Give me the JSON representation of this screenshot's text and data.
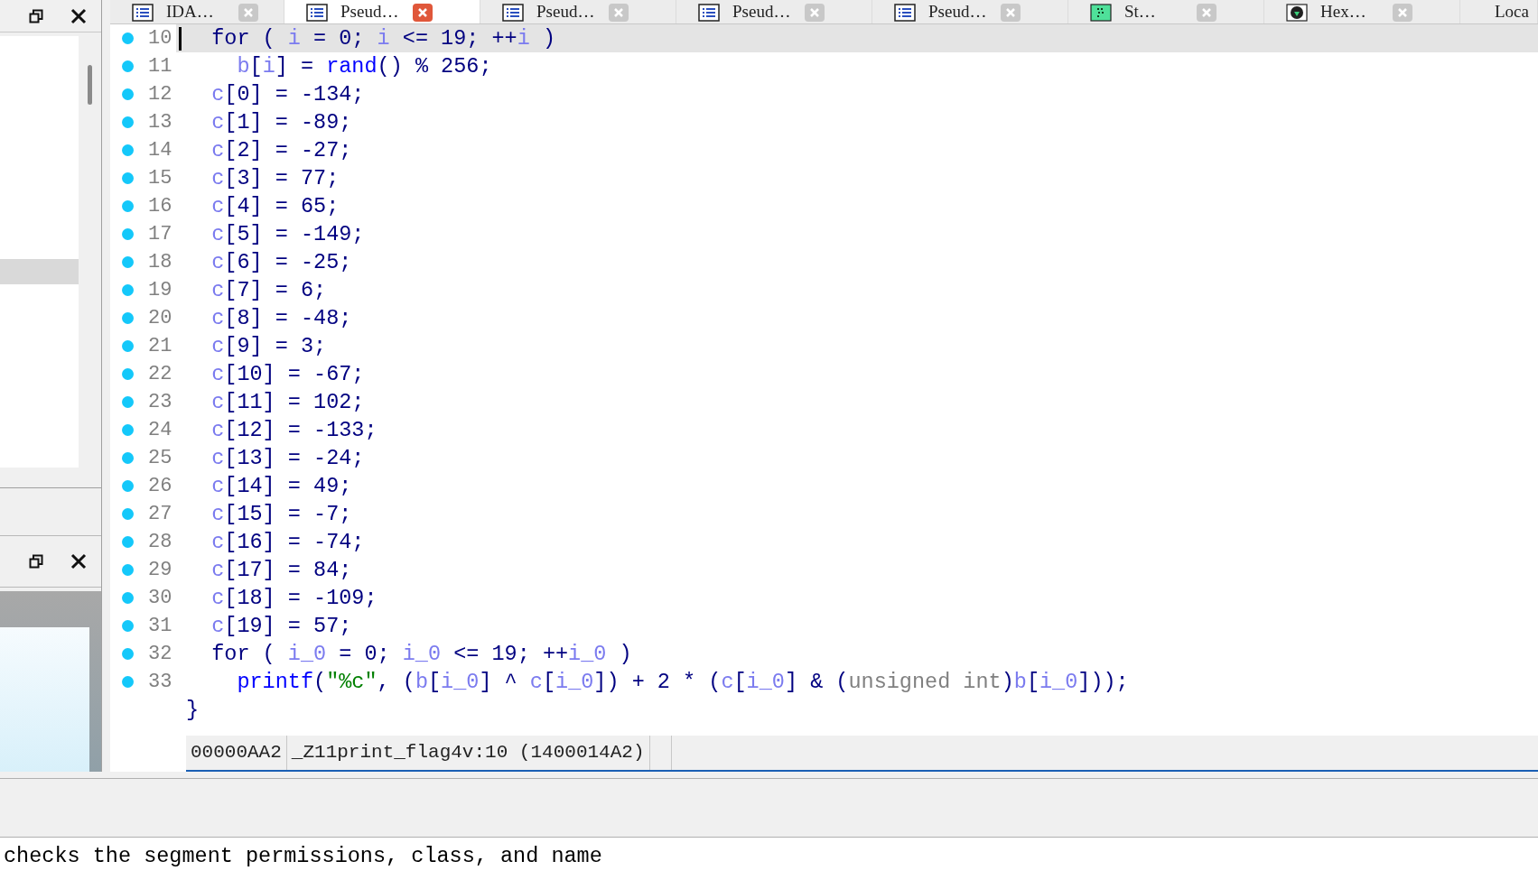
{
  "tabs": [
    {
      "label": "IDA…",
      "kind": "list",
      "selected": false
    },
    {
      "label": "Pseud…",
      "kind": "list",
      "selected": true
    },
    {
      "label": "Pseud…",
      "kind": "list",
      "selected": false
    },
    {
      "label": "Pseud…",
      "kind": "list",
      "selected": false
    },
    {
      "label": "Pseud…",
      "kind": "list",
      "selected": false
    },
    {
      "label": "St…",
      "kind": "strings",
      "selected": false
    },
    {
      "label": "Hex…",
      "kind": "hex",
      "selected": false
    },
    {
      "label": "Loca",
      "kind": "locals",
      "selected": false
    }
  ],
  "code_lines": [
    {
      "number": "10",
      "current": true,
      "tokens": [
        {
          "kind": "plain",
          "text": "  for ( "
        },
        {
          "kind": "var",
          "text": "i"
        },
        {
          "kind": "plain",
          "text": " = 0; "
        },
        {
          "kind": "var",
          "text": "i"
        },
        {
          "kind": "plain",
          "text": " <= 19; ++"
        },
        {
          "kind": "var",
          "text": "i"
        },
        {
          "kind": "plain",
          "text": " )"
        }
      ]
    },
    {
      "number": "11",
      "current": false,
      "tokens": [
        {
          "kind": "var",
          "text": "    b"
        },
        {
          "kind": "plain",
          "text": "["
        },
        {
          "kind": "var",
          "text": "i"
        },
        {
          "kind": "plain",
          "text": "] = "
        },
        {
          "kind": "func",
          "text": "rand"
        },
        {
          "kind": "plain",
          "text": "() % 256;"
        }
      ]
    },
    {
      "number": "12",
      "current": false,
      "tokens": [
        {
          "kind": "var",
          "text": "  c"
        },
        {
          "kind": "plain",
          "text": "[0] = -134;"
        }
      ]
    },
    {
      "number": "13",
      "current": false,
      "tokens": [
        {
          "kind": "var",
          "text": "  c"
        },
        {
          "kind": "plain",
          "text": "[1] = -89;"
        }
      ]
    },
    {
      "number": "14",
      "current": false,
      "tokens": [
        {
          "kind": "var",
          "text": "  c"
        },
        {
          "kind": "plain",
          "text": "[2] = -27;"
        }
      ]
    },
    {
      "number": "15",
      "current": false,
      "tokens": [
        {
          "kind": "var",
          "text": "  c"
        },
        {
          "kind": "plain",
          "text": "[3] = 77;"
        }
      ]
    },
    {
      "number": "16",
      "current": false,
      "tokens": [
        {
          "kind": "var",
          "text": "  c"
        },
        {
          "kind": "plain",
          "text": "[4] = 65;"
        }
      ]
    },
    {
      "number": "17",
      "current": false,
      "tokens": [
        {
          "kind": "var",
          "text": "  c"
        },
        {
          "kind": "plain",
          "text": "[5] = -149;"
        }
      ]
    },
    {
      "number": "18",
      "current": false,
      "tokens": [
        {
          "kind": "var",
          "text": "  c"
        },
        {
          "kind": "plain",
          "text": "[6] = -25;"
        }
      ]
    },
    {
      "number": "19",
      "current": false,
      "tokens": [
        {
          "kind": "var",
          "text": "  c"
        },
        {
          "kind": "plain",
          "text": "[7] = 6;"
        }
      ]
    },
    {
      "number": "20",
      "current": false,
      "tokens": [
        {
          "kind": "var",
          "text": "  c"
        },
        {
          "kind": "plain",
          "text": "[8] = -48;"
        }
      ]
    },
    {
      "number": "21",
      "current": false,
      "tokens": [
        {
          "kind": "var",
          "text": "  c"
        },
        {
          "kind": "plain",
          "text": "[9] = 3;"
        }
      ]
    },
    {
      "number": "22",
      "current": false,
      "tokens": [
        {
          "kind": "var",
          "text": "  c"
        },
        {
          "kind": "plain",
          "text": "[10] = -67;"
        }
      ]
    },
    {
      "number": "23",
      "current": false,
      "tokens": [
        {
          "kind": "var",
          "text": "  c"
        },
        {
          "kind": "plain",
          "text": "[11] = 102;"
        }
      ]
    },
    {
      "number": "24",
      "current": false,
      "tokens": [
        {
          "kind": "var",
          "text": "  c"
        },
        {
          "kind": "plain",
          "text": "[12] = -133;"
        }
      ]
    },
    {
      "number": "25",
      "current": false,
      "tokens": [
        {
          "kind": "var",
          "text": "  c"
        },
        {
          "kind": "plain",
          "text": "[13] = -24;"
        }
      ]
    },
    {
      "number": "26",
      "current": false,
      "tokens": [
        {
          "kind": "var",
          "text": "  c"
        },
        {
          "kind": "plain",
          "text": "[14] = 49;"
        }
      ]
    },
    {
      "number": "27",
      "current": false,
      "tokens": [
        {
          "kind": "var",
          "text": "  c"
        },
        {
          "kind": "plain",
          "text": "[15] = -7;"
        }
      ]
    },
    {
      "number": "28",
      "current": false,
      "tokens": [
        {
          "kind": "var",
          "text": "  c"
        },
        {
          "kind": "plain",
          "text": "[16] = -74;"
        }
      ]
    },
    {
      "number": "29",
      "current": false,
      "tokens": [
        {
          "kind": "var",
          "text": "  c"
        },
        {
          "kind": "plain",
          "text": "[17] = 84;"
        }
      ]
    },
    {
      "number": "30",
      "current": false,
      "tokens": [
        {
          "kind": "var",
          "text": "  c"
        },
        {
          "kind": "plain",
          "text": "[18] = -109;"
        }
      ]
    },
    {
      "number": "31",
      "current": false,
      "tokens": [
        {
          "kind": "var",
          "text": "  c"
        },
        {
          "kind": "plain",
          "text": "[19] = 57;"
        }
      ]
    },
    {
      "number": "32",
      "current": false,
      "tokens": [
        {
          "kind": "plain",
          "text": "  for ( "
        },
        {
          "kind": "var",
          "text": "i_0"
        },
        {
          "kind": "plain",
          "text": " = 0; "
        },
        {
          "kind": "var",
          "text": "i_0"
        },
        {
          "kind": "plain",
          "text": " <= 19; ++"
        },
        {
          "kind": "var",
          "text": "i_0"
        },
        {
          "kind": "plain",
          "text": " )"
        }
      ]
    },
    {
      "number": "33",
      "current": false,
      "tokens": [
        {
          "kind": "func",
          "text": "    printf"
        },
        {
          "kind": "plain",
          "text": "("
        },
        {
          "kind": "string",
          "text": "\"%c\""
        },
        {
          "kind": "plain",
          "text": ", ("
        },
        {
          "kind": "var",
          "text": "b"
        },
        {
          "kind": "plain",
          "text": "["
        },
        {
          "kind": "var",
          "text": "i_0"
        },
        {
          "kind": "plain",
          "text": "] ^ "
        },
        {
          "kind": "var",
          "text": "c"
        },
        {
          "kind": "plain",
          "text": "["
        },
        {
          "kind": "var",
          "text": "i_0"
        },
        {
          "kind": "plain",
          "text": "]) + 2 * ("
        },
        {
          "kind": "var",
          "text": "c"
        },
        {
          "kind": "plain",
          "text": "["
        },
        {
          "kind": "var",
          "text": "i_0"
        },
        {
          "kind": "plain",
          "text": "] & ("
        },
        {
          "kind": "type",
          "text": "unsigned int"
        },
        {
          "kind": "plain",
          "text": ")"
        },
        {
          "kind": "var",
          "text": "b"
        },
        {
          "kind": "plain",
          "text": "["
        },
        {
          "kind": "var",
          "text": "i_0"
        },
        {
          "kind": "plain",
          "text": "]));"
        }
      ]
    },
    {
      "tokens": [
        {
          "kind": "plain",
          "text": "}"
        }
      ],
      "current": false
    }
  ],
  "status_bar": [
    "00000AA2",
    "_Z11print_flag4v:10 (1400014A2)"
  ],
  "output": "checks the segment permissions, class, and name"
}
